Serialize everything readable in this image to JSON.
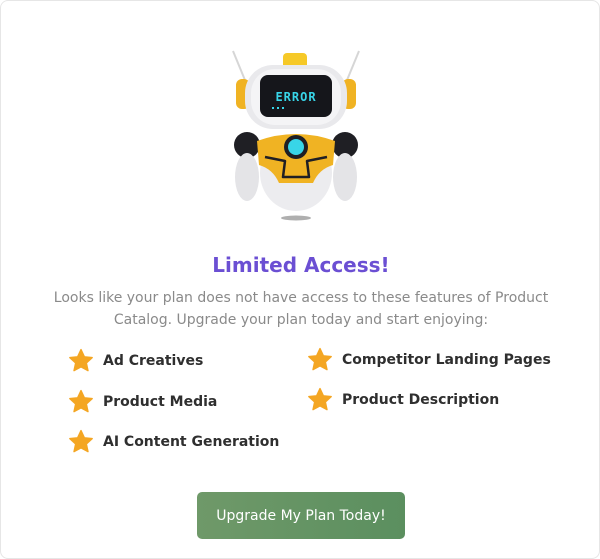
{
  "dialog": {
    "robot_screen_text": "ERROR",
    "title": "Limited Access!",
    "description": "Looks like your plan does not have access to these features of Product Catalog. Upgrade your plan today and start enjoying:",
    "features": [
      {
        "label": "Ad Creatives",
        "icon": "star-icon"
      },
      {
        "label": "Competitor Landing Pages",
        "icon": "star-icon"
      },
      {
        "label": "Product Media",
        "icon": "star-icon"
      },
      {
        "label": "Product Description",
        "icon": "star-icon"
      },
      {
        "label": "AI Content Generation",
        "icon": "star-icon"
      }
    ],
    "cta_label": "Upgrade My Plan Today!"
  },
  "colors": {
    "title": "#6b4fd3",
    "star": "#f4a623",
    "button": "#5f9262",
    "robot_accent": "#f0b323",
    "robot_eye": "#38d5e8"
  }
}
